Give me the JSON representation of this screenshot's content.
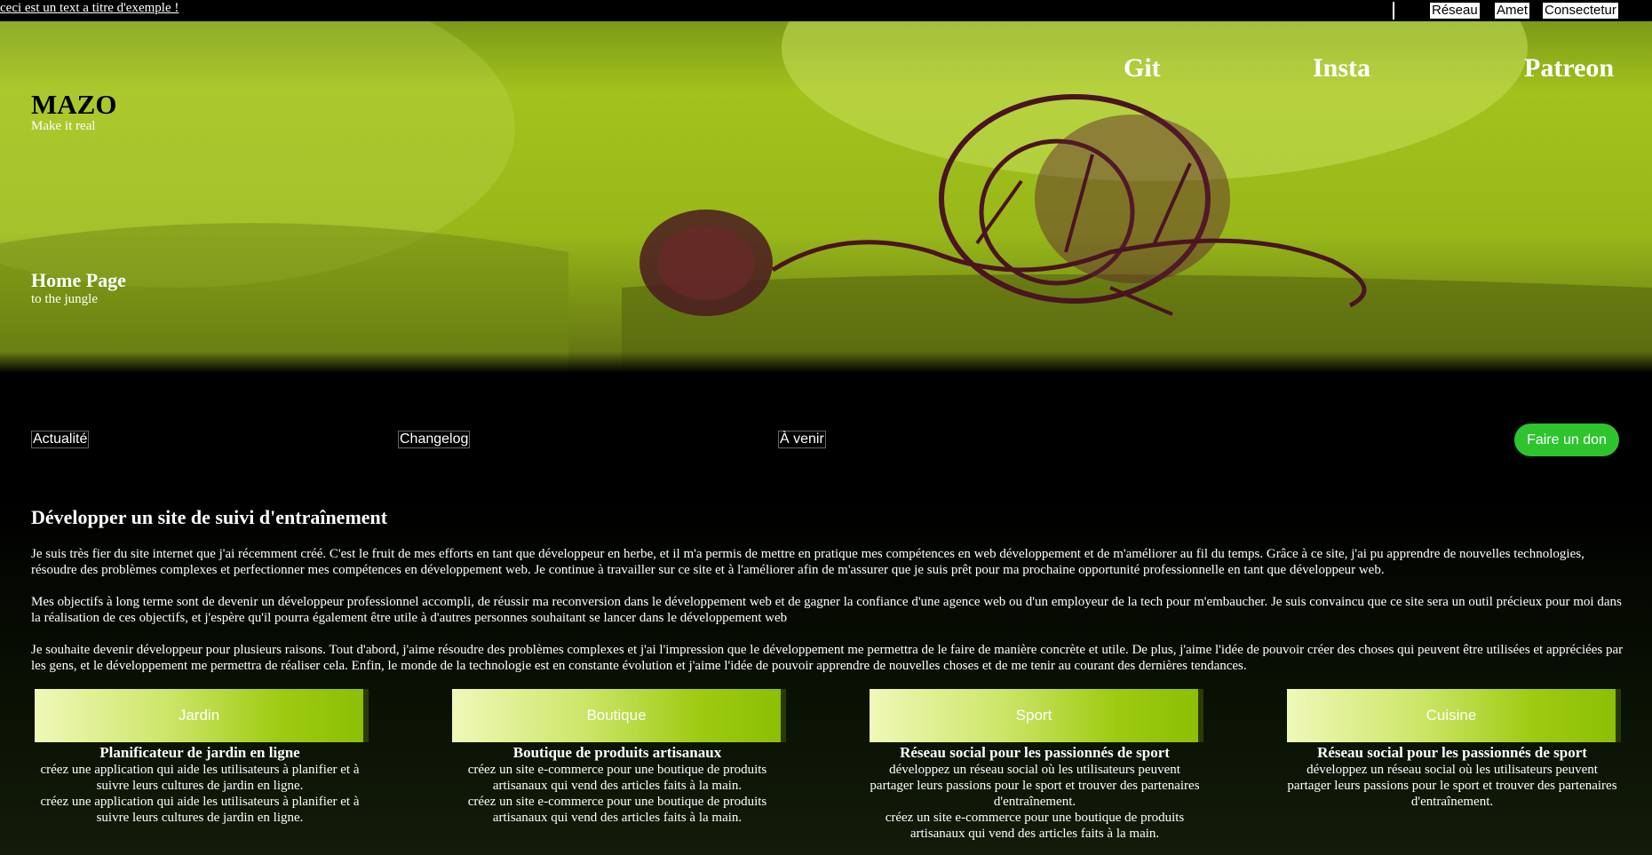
{
  "topbar": {
    "title": "ceci est un text a titre d'exemple !",
    "links": [
      "Réseau",
      "Amet",
      "Consectetur"
    ]
  },
  "brand": {
    "name": "MAZO",
    "tagline": "Make it real"
  },
  "social": [
    "Git",
    "Insta",
    "Patreon"
  ],
  "hero": {
    "heading": "Home Page",
    "subheading": "to the jungle"
  },
  "nav": {
    "items": [
      "Actualité",
      "Changelog",
      "À venir"
    ],
    "donate": "Faire un don"
  },
  "article": {
    "title": "Développer un site de suivi d'entraînement",
    "paragraphs": [
      "Je suis très fier du site internet que j'ai récemment créé. C'est le fruit de mes efforts en tant que développeur en herbe, et il m'a permis de mettre en pratique mes compétences en web développement et de m'améliorer au fil du temps. Grâce à ce site, j'ai pu apprendre de nouvelles technologies, résoudre des problèmes complexes et perfectionner mes compétences en développement web. Je continue à travailler sur ce site et à l'améliorer afin de m'assurer que je suis prêt pour ma prochaine opportunité professionnelle en tant que développeur web.",
      "Mes objectifs à long terme sont de devenir un développeur professionnel accompli, de réussir ma reconversion dans le développement web et de gagner la confiance d'une agence web ou d'un employeur de la tech pour m'embaucher. Je suis convaincu que ce site sera un outil précieux pour moi dans la réalisation de ces objectifs, et j'espère qu'il pourra également être utile à d'autres personnes souhaitant se lancer dans le développement web",
      "Je souhaite devenir développeur pour plusieurs raisons. Tout d'abord, j'aime résoudre des problèmes complexes et j'ai l'impression que le développement me permettra de le faire de manière concrète et utile. De plus, j'aime l'idée de pouvoir créer des choses qui peuvent être utilisées et appréciées par les gens, et le développement me permettra de réaliser cela. Enfin, le monde de la technologie est en constante évolution et j'aime l'idée de pouvoir apprendre de nouvelles choses et de me tenir au courant des dernières tendances."
    ]
  },
  "cards": [
    {
      "label": "Jardin",
      "title": "Planificateur de jardin en ligne",
      "desc": [
        "créez une application qui aide les utilisateurs à planifier et à suivre leurs cultures de jardin en ligne.",
        "créez une application qui aide les utilisateurs à planifier et à suivre leurs cultures de jardin en ligne."
      ]
    },
    {
      "label": "Boutique",
      "title": "Boutique de produits artisanaux",
      "desc": [
        "créez un site e-commerce pour une boutique de produits artisanaux qui vend des articles faits à la main.",
        "créez un site e-commerce pour une boutique de produits artisanaux qui vend des articles faits à la main."
      ]
    },
    {
      "label": "Sport",
      "title": "Réseau social pour les passionnés de sport",
      "desc": [
        "développez un réseau social où les utilisateurs peuvent partager leurs passions pour le sport et trouver des partenaires d'entraînement.",
        "créez un site e-commerce pour une boutique de produits artisanaux qui vend des articles faits à la main."
      ]
    },
    {
      "label": "Cuisine",
      "title": "Réseau social pour les passionnés de sport",
      "desc": [
        "développez un réseau social où les utilisateurs peuvent partager leurs passions pour le sport et trouver des partenaires d'entraînement."
      ]
    }
  ]
}
